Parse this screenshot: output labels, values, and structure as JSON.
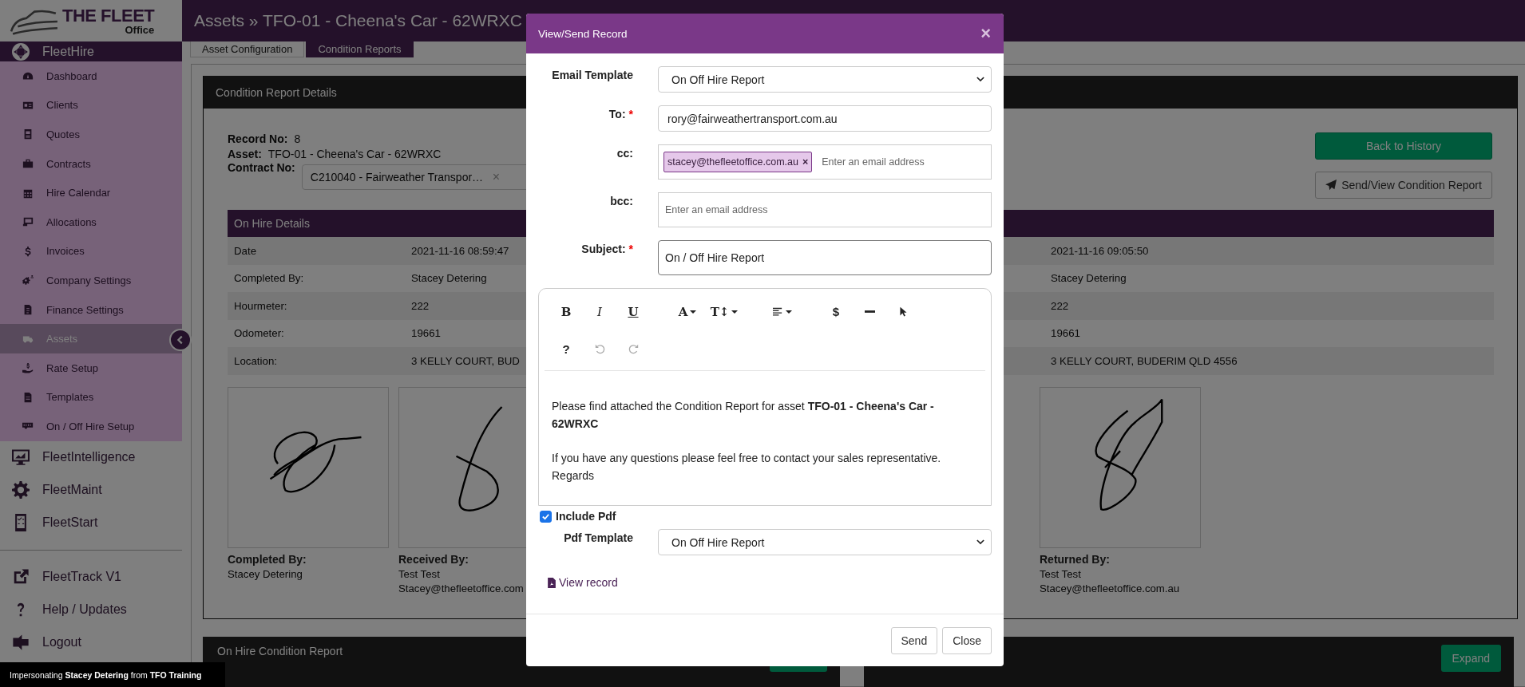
{
  "sidebar": {
    "logo": {
      "title": "THE FLEET",
      "subtitle": "Office"
    },
    "sections": [
      {
        "label": "FleetHire",
        "expanded": true,
        "children": [
          {
            "label": "Dashboard",
            "selected": false
          },
          {
            "label": "Clients",
            "selected": false
          },
          {
            "label": "Quotes",
            "selected": false
          },
          {
            "label": "Contracts",
            "selected": false
          },
          {
            "label": "Hire Calendar",
            "selected": false
          },
          {
            "label": "Allocations",
            "selected": false
          },
          {
            "label": "Invoices",
            "selected": false
          },
          {
            "label": "Company Settings",
            "selected": false
          },
          {
            "label": "Finance Settings",
            "selected": false
          },
          {
            "label": "Assets",
            "selected": true
          },
          {
            "label": "Rate Setup",
            "selected": false
          },
          {
            "label": "Templates",
            "selected": false
          },
          {
            "label": "On / Off Hire Setup",
            "selected": false
          }
        ]
      },
      {
        "label": "FleetIntelligence",
        "expanded": false
      },
      {
        "label": "FleetMaint",
        "expanded": false
      },
      {
        "label": "FleetStart",
        "expanded": false
      }
    ],
    "links": [
      {
        "label": "FleetTrack V1"
      },
      {
        "label": "Help / Updates"
      },
      {
        "label": "Logout"
      }
    ]
  },
  "impersonation": "Impersonating **Stacey Detering** from **TFO Training**",
  "header": {
    "title": "Assets » TFO-01 - Cheena's Car - 62WRXC"
  },
  "tabs": [
    {
      "label": "Asset Configuration",
      "selected": false
    },
    {
      "label": "Condition Reports",
      "selected": true
    }
  ],
  "details": {
    "title": "Condition Report Details",
    "info": [
      {
        "label": "Record No:",
        "value": "8"
      },
      {
        "label": "Asset:",
        "value": "TFO-01 - Cheena's Car - 62WRXC"
      }
    ],
    "contract": {
      "label": "Contract No:",
      "value": "C210040 - Fairweather Transpor…",
      "clear": "×"
    },
    "actions": [
      {
        "label": "Back to History",
        "kind": "primary"
      },
      {
        "label": "Send/View Condition Report",
        "kind": "send"
      }
    ],
    "on_hire": {
      "title": "On Hire Details",
      "rows": [
        {
          "label": "Date",
          "value": "2021-11-16 08:59:47"
        },
        {
          "label": "Completed By:",
          "value": "Stacey Detering"
        },
        {
          "label": "Hourmeter:",
          "value": "222"
        },
        {
          "label": "Odometer:",
          "value": "19661"
        },
        {
          "label": "Location:",
          "value": "3 KELLY COURT, BUD"
        }
      ],
      "signatures": [
        {
          "caption": "Completed By:",
          "lines": [
            "Stacey Detering"
          ]
        },
        {
          "caption": "Received By:",
          "lines": [
            "Test Test",
            "Stacey@thefleetoffice.com"
          ]
        }
      ]
    },
    "off_hire": {
      "rows": [
        {
          "value": "2021-11-16 09:05:50"
        },
        {
          "value": "Stacey Detering"
        },
        {
          "value": "222"
        },
        {
          "value": "19661"
        },
        {
          "value": "3 KELLY COURT, BUDERIM QLD 4556"
        }
      ],
      "signatures": [
        {
          "caption": "Returned By:",
          "lines": [
            "Test Test",
            "Stacey@thefleetoffice.com.au"
          ]
        }
      ]
    }
  },
  "panels": [
    {
      "title": "On Hire Condition Report"
    },
    {
      "button": "Expand"
    }
  ],
  "modal": {
    "title": "View/Send Record",
    "close": "×",
    "fields": [
      {
        "kind": "select",
        "label": "Email Template",
        "value": "On Off Hire Report"
      },
      {
        "kind": "input",
        "label": "To:",
        "mark": "*",
        "value": "rory@fairweathertransport.com.au"
      },
      {
        "kind": "tags",
        "label": "cc:",
        "tags": [
          {
            "text": "stacey@thefleetoffice.com.au",
            "remove": "×"
          }
        ],
        "placeholder": "Enter an email address"
      },
      {
        "kind": "tags",
        "label": "bcc:",
        "placeholder": "Enter an email address"
      },
      {
        "kind": "subject",
        "label": "Subject:",
        "mark": "*",
        "value": "On / Off Hire Report"
      }
    ],
    "toolbar": [
      [
        {
          "kind": "bold",
          "glyph": "B",
          "disabled": false
        },
        {
          "kind": "italic",
          "glyph": "I",
          "disabled": false
        },
        {
          "kind": "underline",
          "glyph": "U",
          "disabled": false
        },
        {
          "kind": "font",
          "glyph": "A",
          "disabled": false
        },
        {
          "kind": "size",
          "glyph": "T↕",
          "disabled": false
        },
        {
          "kind": "align",
          "disabled": false
        },
        {
          "kind": "dollar",
          "glyph": "$",
          "disabled": false
        },
        {
          "kind": "rule",
          "disabled": false
        },
        {
          "kind": "pointer",
          "disabled": false
        }
      ],
      [
        {
          "kind": "help",
          "glyph": "?",
          "disabled": false
        },
        {
          "kind": "undo",
          "disabled": true
        },
        {
          "kind": "redo",
          "disabled": true
        }
      ]
    ],
    "body": [
      [
        "Please find attached the Condition Report for asset **TFO-01 - Cheena's Car - 62WRXC**"
      ],
      [
        "If you have any questions please feel free to contact your sales representative.",
        "Regards"
      ]
    ],
    "include_pdf": {
      "label": "Include Pdf",
      "checked": true
    },
    "pdf_template": {
      "label": "Pdf Template",
      "value": "On Off Hire Report"
    },
    "view_link": "View record",
    "buttons": [
      {
        "label": "Send"
      },
      {
        "label": "Close"
      }
    ]
  }
}
